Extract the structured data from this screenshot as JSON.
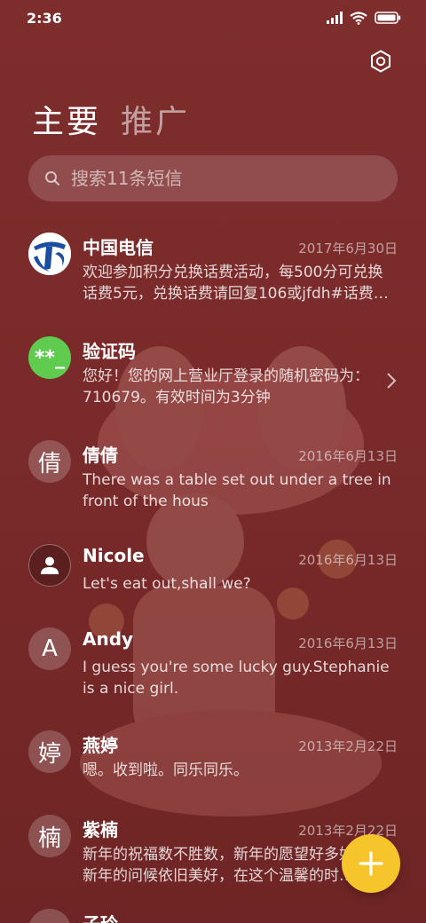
{
  "status_bar": {
    "time": "2:36"
  },
  "tabs": {
    "primary": "主要",
    "secondary": "推广"
  },
  "search": {
    "placeholder": "搜索11条短信"
  },
  "conversations": [
    {
      "name": "中国电信",
      "date": "2017年6月30日",
      "preview": "欢迎参加积分兑换话费活动，每500分可兑换话费5元，兑换话费请回复106或jfdh#话费…",
      "avatar": "china-telecom-logo"
    },
    {
      "name": "验证码",
      "date": "",
      "preview": "您好！您的网上营业厅登录的随机密码为：710679。有效时间为3分钟",
      "avatar": "**_"
    },
    {
      "name": "倩倩",
      "date": "2016年6月13日",
      "preview": "There was a table set out under a tree in front of the hous",
      "avatar": "倩"
    },
    {
      "name": "Nicole",
      "date": "2016年6月13日",
      "preview": "Let's eat out,shall we?",
      "avatar": "person-icon"
    },
    {
      "name": "Andy",
      "date": "2016年6月13日",
      "preview": "I guess you're some lucky guy.Stephanie is a nice girl.",
      "avatar": "A"
    },
    {
      "name": "燕婷",
      "date": "2013年2月22日",
      "preview": "嗯。收到啦。同乐同乐。",
      "avatar": "婷"
    },
    {
      "name": "紫楠",
      "date": "2013年2月22日",
      "preview": "新年的祝福数不胜数，新年的愿望好多好多，新年的问候依旧美好，在这个温馨的时…",
      "avatar": "楠"
    },
    {
      "name": "子玲",
      "date": "",
      "preview": "",
      "avatar": ""
    }
  ],
  "colors": {
    "background": "#7d2b2b",
    "fab": "#f6c42b",
    "verify_avatar": "#5fcc4f",
    "telecom_blue": "#1c4ea0"
  }
}
